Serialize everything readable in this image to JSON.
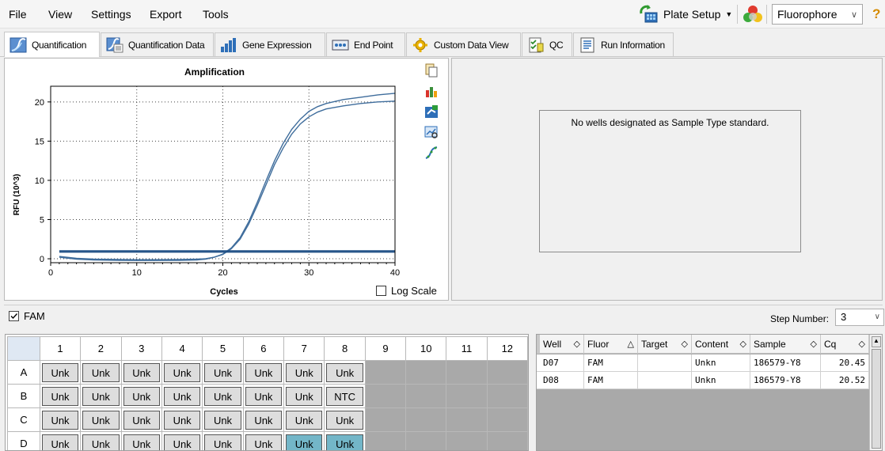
{
  "menu": {
    "file": "File",
    "view": "View",
    "settings": "Settings",
    "export": "Export",
    "tools": "Tools"
  },
  "toolbar": {
    "plate_setup": "Plate Setup",
    "fluorophore": "Fluorophore",
    "help": "?"
  },
  "tabs": [
    {
      "label": "Quantification"
    },
    {
      "label": "Quantification Data"
    },
    {
      "label": "Gene Expression"
    },
    {
      "label": "End Point"
    },
    {
      "label": "Custom Data View"
    },
    {
      "label": "QC"
    },
    {
      "label": "Run Information"
    }
  ],
  "chart_data": {
    "type": "line",
    "title": "Amplification",
    "xlabel": "Cycles",
    "ylabel": "RFU (10^3)",
    "xlim": [
      0,
      40
    ],
    "ylim": [
      -0.5,
      22
    ],
    "xticks": [
      0,
      10,
      20,
      30,
      40
    ],
    "yticks": [
      0,
      5,
      10,
      15,
      20
    ],
    "grid": true,
    "series": [
      {
        "x": [
          1,
          3,
          5,
          8,
          10,
          12,
          15,
          17,
          18,
          19,
          20,
          21,
          22,
          23,
          24,
          25,
          26,
          27,
          28,
          29,
          30,
          31,
          32,
          34,
          36,
          38,
          40
        ],
        "values": [
          0.2,
          -0.05,
          -0.15,
          -0.2,
          -0.22,
          -0.22,
          -0.2,
          -0.15,
          -0.05,
          0.2,
          0.6,
          1.4,
          2.7,
          4.7,
          7.2,
          9.9,
          12.5,
          14.7,
          16.5,
          17.8,
          18.8,
          19.4,
          19.8,
          20.3,
          20.6,
          20.9,
          21.1
        ]
      },
      {
        "x": [
          1,
          3,
          5,
          8,
          10,
          12,
          15,
          17,
          18,
          19,
          20,
          21,
          22,
          23,
          24,
          25,
          26,
          27,
          28,
          29,
          30,
          31,
          32,
          34,
          36,
          38,
          40
        ],
        "values": [
          0.3,
          0.05,
          -0.05,
          -0.1,
          -0.12,
          -0.12,
          -0.1,
          -0.05,
          0.0,
          0.2,
          0.55,
          1.3,
          2.5,
          4.4,
          6.8,
          9.4,
          12.0,
          14.1,
          15.9,
          17.2,
          18.1,
          18.7,
          19.1,
          19.5,
          19.8,
          20.0,
          20.1
        ]
      },
      {
        "x": [
          1,
          40
        ],
        "values": [
          1.0,
          1.0
        ]
      },
      {
        "x": [
          1,
          40
        ],
        "values": [
          0.85,
          0.85
        ]
      }
    ]
  },
  "log_scale": {
    "label": "Log Scale",
    "checked": false
  },
  "no_standard_msg": "No wells designated as Sample Type standard.",
  "fam": {
    "label": "FAM",
    "checked": true
  },
  "step": {
    "label": "Step Number:",
    "value": "3"
  },
  "plate": {
    "columns": [
      "1",
      "2",
      "3",
      "4",
      "5",
      "6",
      "7",
      "8",
      "9",
      "10",
      "11",
      "12"
    ],
    "rows": [
      {
        "label": "A",
        "wells": [
          "Unk",
          "Unk",
          "Unk",
          "Unk",
          "Unk",
          "Unk",
          "Unk",
          "Unk"
        ]
      },
      {
        "label": "B",
        "wells": [
          "Unk",
          "Unk",
          "Unk",
          "Unk",
          "Unk",
          "Unk",
          "Unk",
          "NTC"
        ]
      },
      {
        "label": "C",
        "wells": [
          "Unk",
          "Unk",
          "Unk",
          "Unk",
          "Unk",
          "Unk",
          "Unk",
          "Unk"
        ]
      },
      {
        "label": "D",
        "wells": [
          "Unk",
          "Unk",
          "Unk",
          "Unk",
          "Unk",
          "Unk",
          "Unk",
          "Unk"
        ]
      }
    ],
    "selected": [
      "D7",
      "D8"
    ]
  },
  "well_table": {
    "headers": [
      "Well",
      "Fluor",
      "Target",
      "Content",
      "Sample",
      "Cq"
    ],
    "rows": [
      [
        "D07",
        "FAM",
        "",
        "Unkn",
        "186579-Y8",
        "20.45"
      ],
      [
        "D08",
        "FAM",
        "",
        "Unkn",
        "186579-Y8",
        "20.52"
      ]
    ]
  },
  "colors": {
    "curve": "#3f6d9c",
    "selected_well": "#73b6c8",
    "empty_well": "#a9a9a9"
  }
}
